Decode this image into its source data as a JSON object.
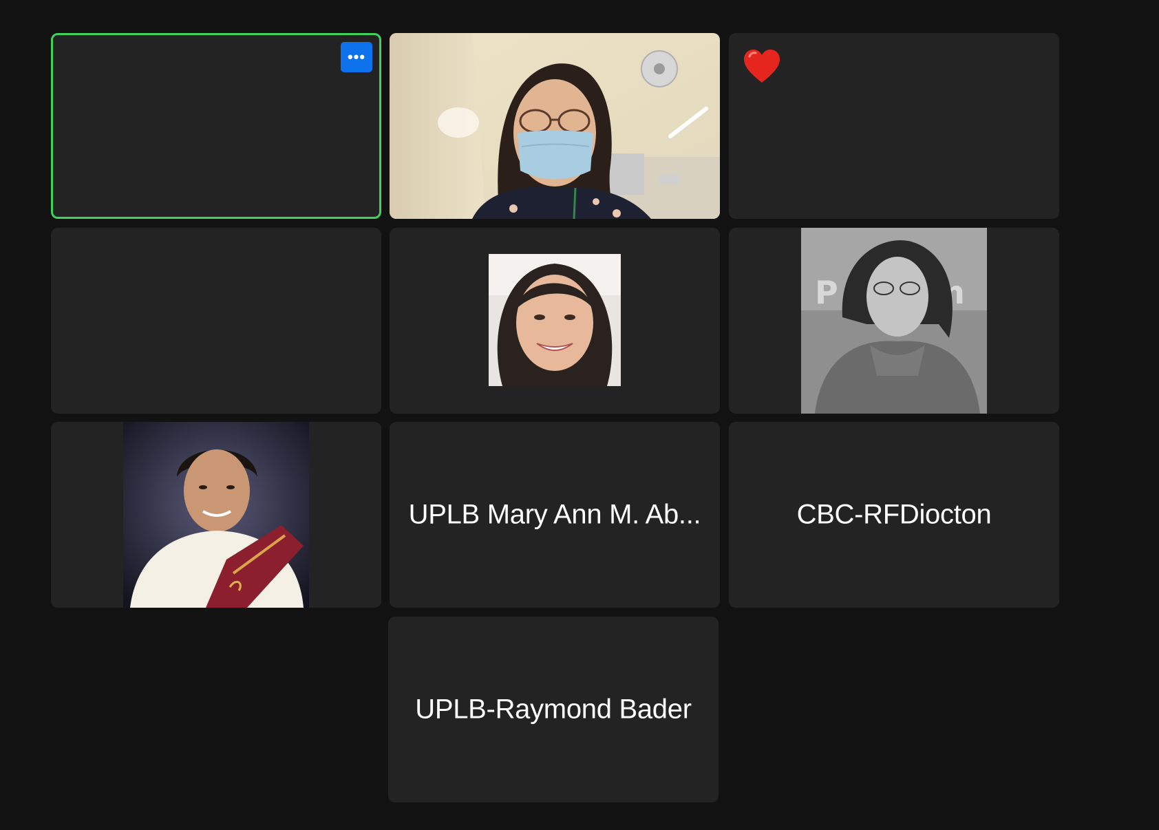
{
  "gallery": {
    "active_tile_border_color": "#3ed35a",
    "tile_more_button": {
      "icon": "ellipsis-icon",
      "label": "•••"
    },
    "tiles": [
      {
        "kind": "empty-active"
      },
      {
        "kind": "video",
        "description": "video-feed"
      },
      {
        "kind": "reaction",
        "reaction_icon": "heart-icon"
      },
      {
        "kind": "empty"
      },
      {
        "kind": "profile-photo"
      },
      {
        "kind": "profile-photo"
      },
      {
        "kind": "profile-photo"
      },
      {
        "kind": "name",
        "name": "UPLB Mary Ann M. Ab..."
      },
      {
        "kind": "name",
        "name": "CBC-RFDiocton"
      },
      {
        "kind": "name",
        "name": "UPLB-Raymond Bader"
      }
    ]
  }
}
